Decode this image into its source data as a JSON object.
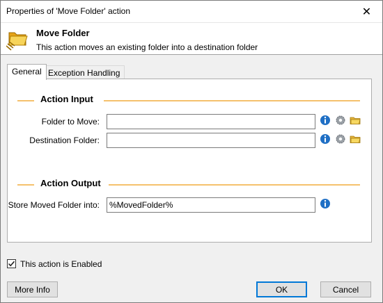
{
  "window": {
    "title": "Properties of 'Move Folder' action",
    "close_glyph": "✕"
  },
  "header": {
    "title": "Move Folder",
    "description": "This action moves an existing folder into a destination folder",
    "icon": "folder-move-icon"
  },
  "tabs": [
    {
      "label": "General",
      "active": true
    },
    {
      "label": "Exception Handling",
      "active": false
    }
  ],
  "sections": {
    "input": {
      "label": "Action Input"
    },
    "output": {
      "label": "Action Output"
    }
  },
  "fields": {
    "folder_to_move": {
      "label": "Folder to Move:",
      "value": ""
    },
    "destination_folder": {
      "label": "Destination Folder:",
      "value": ""
    },
    "store_moved_folder": {
      "label": "Store Moved Folder into:",
      "value": "%MovedFolder%"
    }
  },
  "enabled_checkbox": {
    "label": "This action is Enabled",
    "checked": true
  },
  "buttons": {
    "more_info": "More Info",
    "ok": "OK",
    "cancel": "Cancel"
  },
  "colors": {
    "section_line": "#f5c16c",
    "default_button_border": "#0078d7",
    "info_icon": "#1f6fc5",
    "folder_icon": "#f3c74a"
  }
}
